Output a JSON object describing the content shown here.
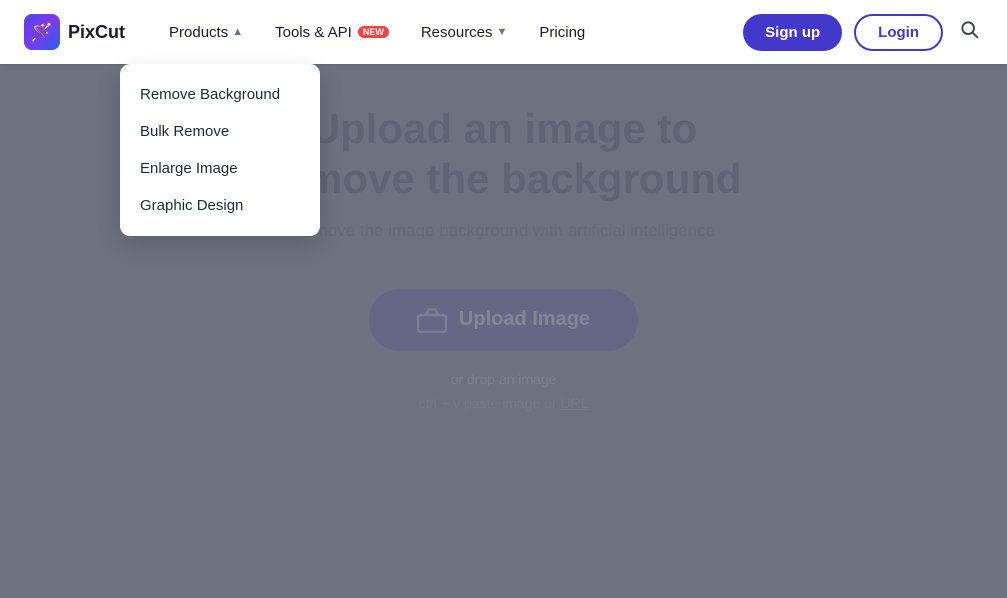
{
  "brand": {
    "name": "PixCut",
    "logo_emoji": "🪄"
  },
  "navbar": {
    "products_label": "Products",
    "tools_api_label": "Tools & API",
    "tools_api_badge": "NEW",
    "resources_label": "Resources",
    "pricing_label": "Pricing",
    "signup_label": "Sign up",
    "login_label": "Login"
  },
  "dropdown": {
    "items": [
      {
        "label": "Remove Background"
      },
      {
        "label": "Bulk Remove"
      },
      {
        "label": "Enlarge Image"
      },
      {
        "label": "Graphic Design"
      }
    ]
  },
  "hero": {
    "title_line1": "Upload an image to",
    "title_line2": "remove the background",
    "subtitle": "Remove the image background with artificial intelligence",
    "upload_button": "Upload Image",
    "drop_text": "or drop an image",
    "paste_text": "ctrl + v paste image or ",
    "url_label": "URL"
  }
}
